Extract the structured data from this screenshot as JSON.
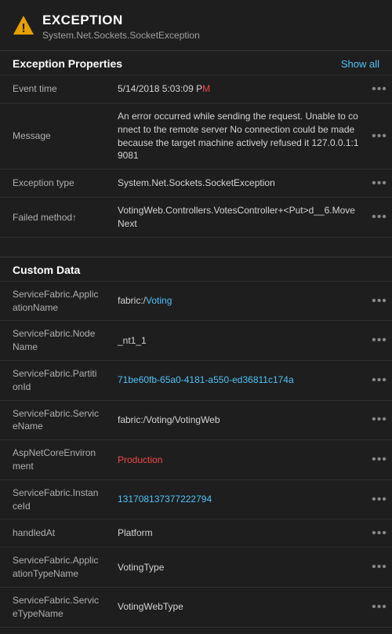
{
  "header": {
    "title": "EXCEPTION",
    "subtitle": "System.Net.Sockets.SocketException",
    "icon": "⚠"
  },
  "exception_properties": {
    "section_title": "Exception Properties",
    "show_all_label": "Show all",
    "rows": [
      {
        "key": "Event time",
        "value": "5/14/2018 5:03:09 PM",
        "highlight_part": "M",
        "highlight_index": 21
      },
      {
        "key": "Message",
        "value": "An error occurred while sending the request. Unable to connect to the remote server No connection could be made because the target machine actively refused it 127.0.0.1:19081",
        "highlight_part": null
      },
      {
        "key": "Exception type",
        "value": "System.Net.Sockets.SocketException",
        "highlight_part": null
      },
      {
        "key": "Failed method",
        "value": "VotingWeb.Controllers.VotesController+<Put>d__6.MoveNext",
        "highlight_part": null
      }
    ]
  },
  "custom_data": {
    "section_title": "Custom Data",
    "rows": [
      {
        "key": "ServiceFabric.ApplicationName",
        "value": "fabric:/Voting",
        "value_prefix": "fabric:/",
        "value_highlight": "Voting",
        "is_link": true
      },
      {
        "key": "ServiceFabric.NodeName",
        "value": "_nt1_1",
        "is_link": false
      },
      {
        "key": "ServiceFabric.PartitionId",
        "value": "71be60fb-65a0-4181-a550-ed36811c174a",
        "is_link": true
      },
      {
        "key": "ServiceFabric.ServiceName",
        "value": "fabric:/Voting/VotingWeb",
        "is_link": false
      },
      {
        "key": "AspNetCoreEnvironment",
        "value": "Production",
        "is_link": false,
        "highlight_all": true
      },
      {
        "key": "ServiceFabric.InstanceId",
        "value": "131708137377222794",
        "is_link": true
      },
      {
        "key": "handledAt",
        "value": "Platform",
        "is_link": false
      },
      {
        "key": "ServiceFabric.ApplicationTypeName",
        "value": "VotingType",
        "is_link": false
      },
      {
        "key": "ServiceFabric.ServiceTypeName",
        "value": "VotingWebType",
        "is_link": false
      }
    ]
  },
  "dots_label": "•••"
}
